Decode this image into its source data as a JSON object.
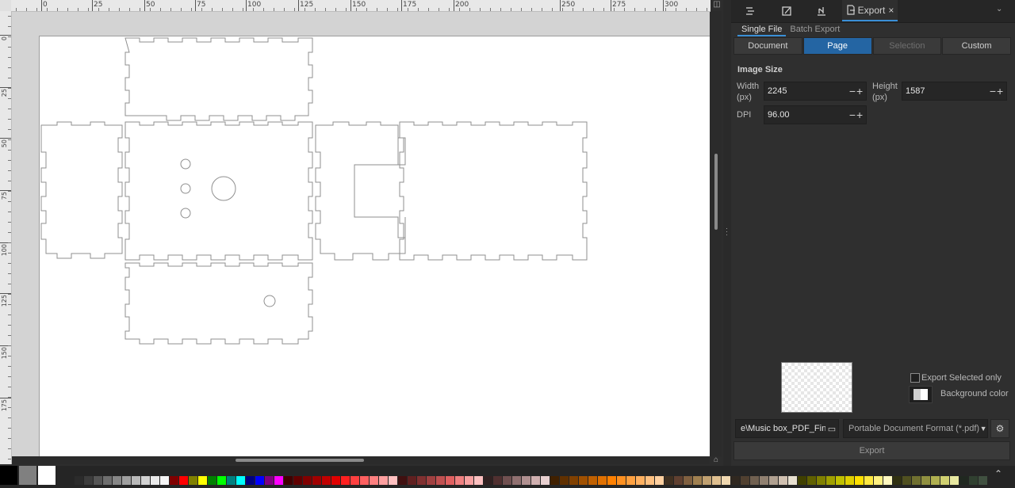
{
  "rulers": {
    "horizontal_ticks": [
      "0",
      "25",
      "50",
      "75",
      "100",
      "125",
      "150",
      "175",
      "200",
      "250",
      "275",
      "300"
    ],
    "vertical_ticks": [
      "0",
      "25",
      "50",
      "75",
      "100",
      "125",
      "150",
      "175"
    ]
  },
  "dock": {
    "tabs": [
      {
        "name": "objects-tab",
        "icon": "layers-icon"
      },
      {
        "name": "fill-stroke-tab",
        "icon": "brush-icon"
      },
      {
        "name": "align-tab",
        "icon": "align-icon"
      },
      {
        "name": "export-tab",
        "icon": "export-icon",
        "label": "Export"
      }
    ],
    "close_symbol": "×",
    "mode_tabs": [
      "Single File",
      "Batch Export"
    ],
    "area_buttons": [
      {
        "label": "Document",
        "state": "normal"
      },
      {
        "label": "Page",
        "state": "active"
      },
      {
        "label": "Selection",
        "state": "disabled"
      },
      {
        "label": "Custom",
        "state": "normal"
      }
    ],
    "image_size_title": "Image Size",
    "width_label": "Width",
    "width_unit": "(px)",
    "width_value": "2245",
    "height_label": "Height",
    "height_unit": "(px)",
    "height_value": "1587",
    "dpi_label": "DPI",
    "dpi_value": "96.00",
    "minus": "−",
    "plus": "+",
    "export_selected_label": "Export Selected only",
    "background_color_label": "Background color",
    "filename": "e\\Music box_PDF_Final",
    "format": "Portable Document Format (*.pdf)",
    "export_button": "Export"
  },
  "colors": {
    "accent": "#2465a3",
    "tab_underline": "#3a8fd6"
  },
  "palette": {
    "primary": [
      "#000000",
      "#808080",
      "#ffffff"
    ],
    "swatches": [
      "#2b2b2b",
      "#3c3c3c",
      "#555555",
      "#6e6e6e",
      "#878787",
      "#a0a0a0",
      "#b9b9b9",
      "#d2d2d2",
      "#ebebeb",
      "#f5f5f5",
      "#800000",
      "#ff0000",
      "#808000",
      "#ffff00",
      "#008000",
      "#00ff00",
      "#008080",
      "#00ffff",
      "#000080",
      "#0000ff",
      "#800080",
      "#ff00ff",
      "#400000",
      "#600000",
      "#800000",
      "#a00000",
      "#c00000",
      "#e00000",
      "#ff2020",
      "#ff4040",
      "#ff6060",
      "#ff8080",
      "#ffa0a0",
      "#ffc0c0",
      "#401010",
      "#602020",
      "#803030",
      "#a04040",
      "#c05050",
      "#e06060",
      "#f08080",
      "#f8a0a0",
      "#fcc0c0",
      "#302020",
      "#503030",
      "#705050",
      "#907070",
      "#b09090",
      "#d0b0b0",
      "#e8d0d0",
      "#402000",
      "#603000",
      "#804000",
      "#a05000",
      "#c06000",
      "#e07000",
      "#ff8000",
      "#ff9020",
      "#ffa040",
      "#ffb060",
      "#ffc080",
      "#ffd0a0",
      "#403020",
      "#604030",
      "#806040",
      "#a08050",
      "#c0a070",
      "#e0c090",
      "#f0d8b0",
      "#302820",
      "#504030",
      "#706050",
      "#908070",
      "#b0a090",
      "#d0c0b0",
      "#e8e0d0",
      "#404000",
      "#606000",
      "#808000",
      "#a0a000",
      "#c0c000",
      "#e0d000",
      "#ffe000",
      "#ffe840",
      "#fff080",
      "#fff8c0",
      "#303010",
      "#505020",
      "#707030",
      "#909040",
      "#b0b050",
      "#d0d070",
      "#e8e8a0",
      "#202820",
      "#304030",
      "#405040"
    ]
  }
}
